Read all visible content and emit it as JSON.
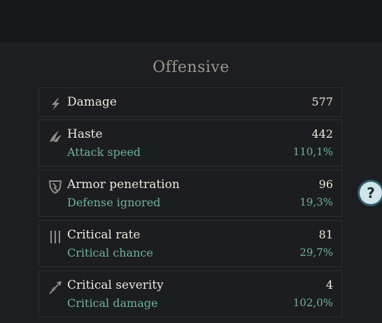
{
  "section": {
    "title": "Offensive"
  },
  "help": {
    "label": "?"
  },
  "stats": [
    {
      "icon": "lightning-icon",
      "name": "Damage",
      "value": "577"
    },
    {
      "icon": "wings-icon",
      "name": "Haste",
      "value": "442",
      "sub_name": "Attack speed",
      "sub_value": "110,1%"
    },
    {
      "icon": "broken-shield-icon",
      "name": "Armor penetration",
      "value": "96",
      "sub_name": "Defense ignored",
      "sub_value": "19,3%"
    },
    {
      "icon": "triple-blades-icon",
      "name": "Critical rate",
      "value": "81",
      "sub_name": "Critical chance",
      "sub_value": "29,7%"
    },
    {
      "icon": "spear-icon",
      "name": "Critical severity",
      "value": "4",
      "sub_name": "Critical damage",
      "sub_value": "102,0%"
    }
  ],
  "colors": {
    "primary_text": "#ece8df",
    "secondary_text": "#6fb0a3",
    "title_text": "#9a9890",
    "help_accent": "#2e5f6b"
  }
}
